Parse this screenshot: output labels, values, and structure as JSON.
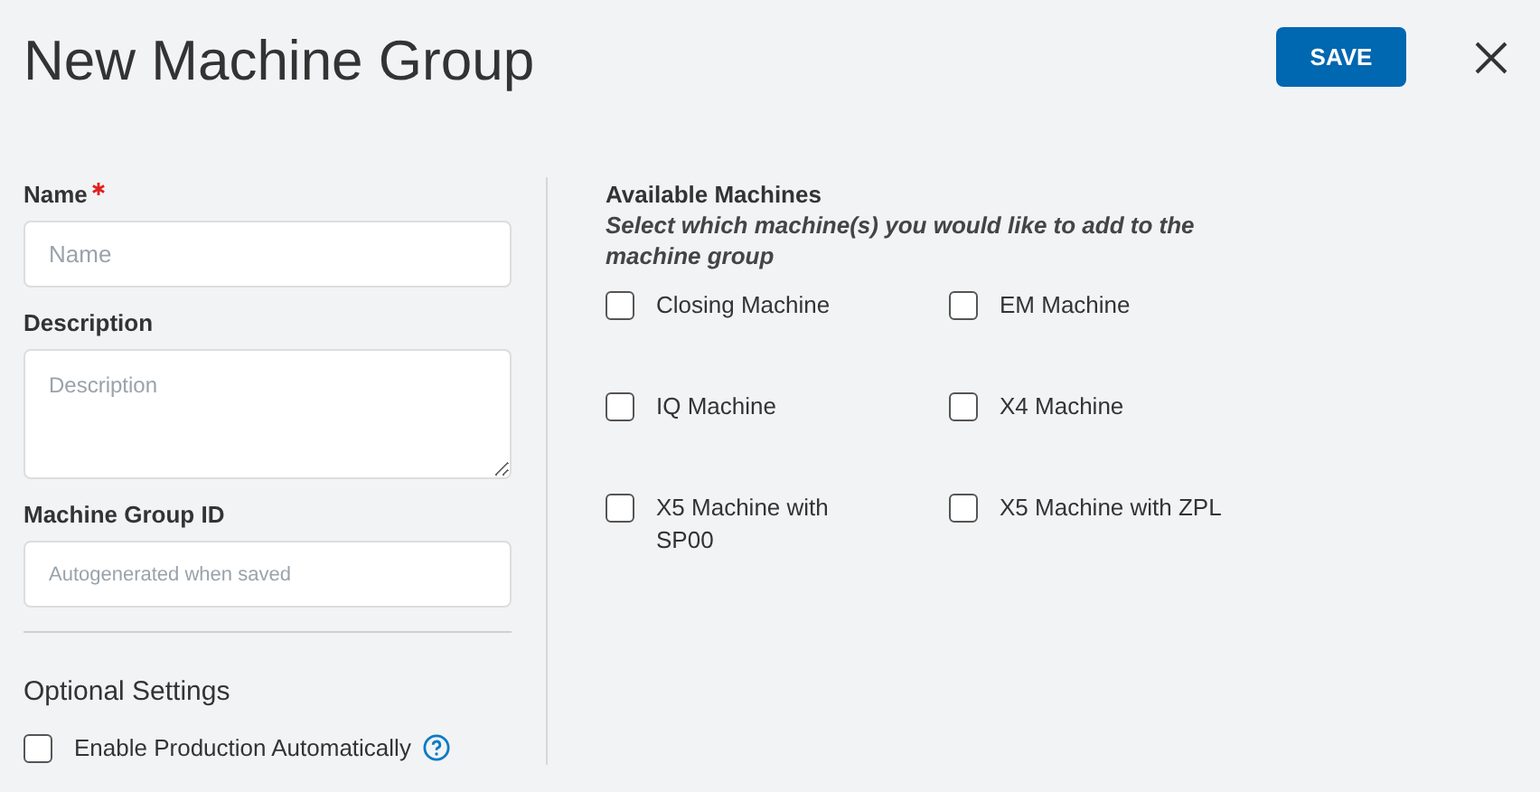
{
  "title": "New Machine Group",
  "save_button": "SAVE",
  "form": {
    "fields": [
      {
        "kind": "input",
        "label": "Name",
        "required": true,
        "placeholder": "Name"
      },
      {
        "kind": "textarea",
        "label": "Description",
        "required": false,
        "placeholder": "Description"
      },
      {
        "kind": "input",
        "label": "Machine Group ID",
        "required": false,
        "placeholder": "Autogenerated when saved"
      }
    ],
    "optional_settings": {
      "heading": "Optional Settings",
      "items": [
        {
          "label": "Enable Production Automatically",
          "checked": false,
          "help": true
        }
      ]
    }
  },
  "available_machines": {
    "heading": "Available Machines",
    "hint": "Select which machine(s) you would like to add to the machine group",
    "machines": [
      {
        "label": "Closing Machine",
        "checked": false
      },
      {
        "label": "EM Machine",
        "checked": false
      },
      {
        "label": "IQ Machine",
        "checked": false
      },
      {
        "label": "X4 Machine",
        "checked": false
      },
      {
        "label": "X5 Machine with SP00",
        "checked": false
      },
      {
        "label": "X5 Machine with ZPL",
        "checked": false
      }
    ]
  }
}
